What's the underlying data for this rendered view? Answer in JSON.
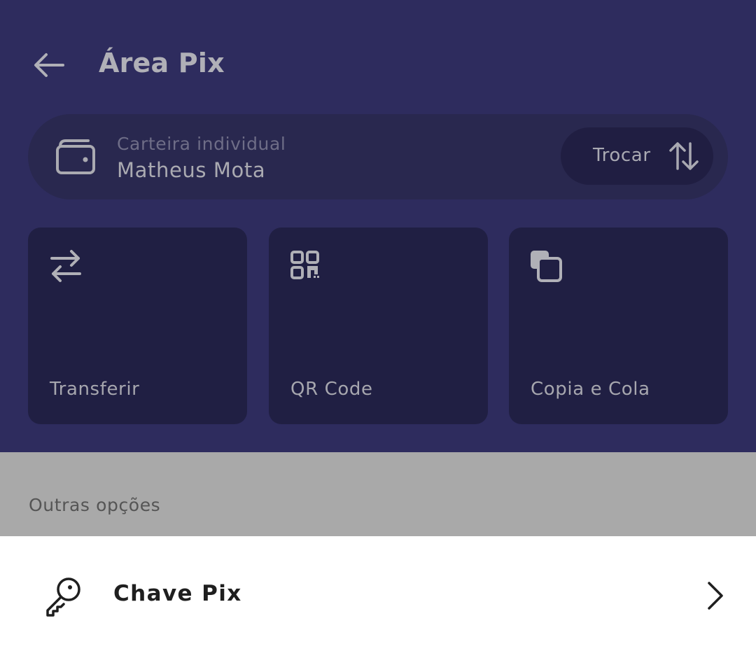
{
  "header": {
    "title": "Área Pix",
    "back_icon": "arrow-left-icon"
  },
  "wallet": {
    "label": "Carteira individual",
    "name": "Matheus Mota",
    "icon": "wallet-icon",
    "swap_label": "Trocar",
    "swap_icon": "swap-vertical-icon"
  },
  "actions": [
    {
      "label": "Transferir",
      "icon": "transfer-arrows-icon"
    },
    {
      "label": "QR Code",
      "icon": "qr-code-icon"
    },
    {
      "label": "Copia e Cola",
      "icon": "copy-icon"
    }
  ],
  "other_options": {
    "title": "Outras opções",
    "items": [
      {
        "label": "Chave Pix",
        "icon": "key-icon",
        "chevron_icon": "chevron-right-icon"
      }
    ]
  },
  "colors": {
    "header_bg": "#2e2c5e",
    "card_bg": "#201f43",
    "overlay_gray": "#a9a9a9",
    "text_light": "#b0b0b7"
  }
}
